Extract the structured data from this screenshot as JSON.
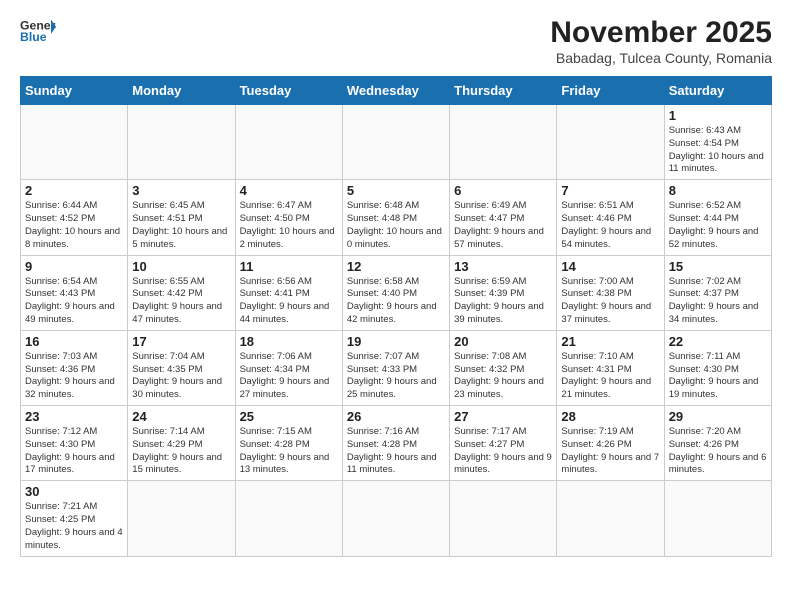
{
  "header": {
    "logo_general": "General",
    "logo_blue": "Blue",
    "month_title": "November 2025",
    "location": "Babadag, Tulcea County, Romania"
  },
  "days_of_week": [
    "Sunday",
    "Monday",
    "Tuesday",
    "Wednesday",
    "Thursday",
    "Friday",
    "Saturday"
  ],
  "weeks": [
    [
      {
        "day": "",
        "info": ""
      },
      {
        "day": "",
        "info": ""
      },
      {
        "day": "",
        "info": ""
      },
      {
        "day": "",
        "info": ""
      },
      {
        "day": "",
        "info": ""
      },
      {
        "day": "",
        "info": ""
      },
      {
        "day": "1",
        "info": "Sunrise: 6:43 AM\nSunset: 4:54 PM\nDaylight: 10 hours and 11 minutes."
      }
    ],
    [
      {
        "day": "2",
        "info": "Sunrise: 6:44 AM\nSunset: 4:52 PM\nDaylight: 10 hours and 8 minutes."
      },
      {
        "day": "3",
        "info": "Sunrise: 6:45 AM\nSunset: 4:51 PM\nDaylight: 10 hours and 5 minutes."
      },
      {
        "day": "4",
        "info": "Sunrise: 6:47 AM\nSunset: 4:50 PM\nDaylight: 10 hours and 2 minutes."
      },
      {
        "day": "5",
        "info": "Sunrise: 6:48 AM\nSunset: 4:48 PM\nDaylight: 10 hours and 0 minutes."
      },
      {
        "day": "6",
        "info": "Sunrise: 6:49 AM\nSunset: 4:47 PM\nDaylight: 9 hours and 57 minutes."
      },
      {
        "day": "7",
        "info": "Sunrise: 6:51 AM\nSunset: 4:46 PM\nDaylight: 9 hours and 54 minutes."
      },
      {
        "day": "8",
        "info": "Sunrise: 6:52 AM\nSunset: 4:44 PM\nDaylight: 9 hours and 52 minutes."
      }
    ],
    [
      {
        "day": "9",
        "info": "Sunrise: 6:54 AM\nSunset: 4:43 PM\nDaylight: 9 hours and 49 minutes."
      },
      {
        "day": "10",
        "info": "Sunrise: 6:55 AM\nSunset: 4:42 PM\nDaylight: 9 hours and 47 minutes."
      },
      {
        "day": "11",
        "info": "Sunrise: 6:56 AM\nSunset: 4:41 PM\nDaylight: 9 hours and 44 minutes."
      },
      {
        "day": "12",
        "info": "Sunrise: 6:58 AM\nSunset: 4:40 PM\nDaylight: 9 hours and 42 minutes."
      },
      {
        "day": "13",
        "info": "Sunrise: 6:59 AM\nSunset: 4:39 PM\nDaylight: 9 hours and 39 minutes."
      },
      {
        "day": "14",
        "info": "Sunrise: 7:00 AM\nSunset: 4:38 PM\nDaylight: 9 hours and 37 minutes."
      },
      {
        "day": "15",
        "info": "Sunrise: 7:02 AM\nSunset: 4:37 PM\nDaylight: 9 hours and 34 minutes."
      }
    ],
    [
      {
        "day": "16",
        "info": "Sunrise: 7:03 AM\nSunset: 4:36 PM\nDaylight: 9 hours and 32 minutes."
      },
      {
        "day": "17",
        "info": "Sunrise: 7:04 AM\nSunset: 4:35 PM\nDaylight: 9 hours and 30 minutes."
      },
      {
        "day": "18",
        "info": "Sunrise: 7:06 AM\nSunset: 4:34 PM\nDaylight: 9 hours and 27 minutes."
      },
      {
        "day": "19",
        "info": "Sunrise: 7:07 AM\nSunset: 4:33 PM\nDaylight: 9 hours and 25 minutes."
      },
      {
        "day": "20",
        "info": "Sunrise: 7:08 AM\nSunset: 4:32 PM\nDaylight: 9 hours and 23 minutes."
      },
      {
        "day": "21",
        "info": "Sunrise: 7:10 AM\nSunset: 4:31 PM\nDaylight: 9 hours and 21 minutes."
      },
      {
        "day": "22",
        "info": "Sunrise: 7:11 AM\nSunset: 4:30 PM\nDaylight: 9 hours and 19 minutes."
      }
    ],
    [
      {
        "day": "23",
        "info": "Sunrise: 7:12 AM\nSunset: 4:30 PM\nDaylight: 9 hours and 17 minutes."
      },
      {
        "day": "24",
        "info": "Sunrise: 7:14 AM\nSunset: 4:29 PM\nDaylight: 9 hours and 15 minutes."
      },
      {
        "day": "25",
        "info": "Sunrise: 7:15 AM\nSunset: 4:28 PM\nDaylight: 9 hours and 13 minutes."
      },
      {
        "day": "26",
        "info": "Sunrise: 7:16 AM\nSunset: 4:28 PM\nDaylight: 9 hours and 11 minutes."
      },
      {
        "day": "27",
        "info": "Sunrise: 7:17 AM\nSunset: 4:27 PM\nDaylight: 9 hours and 9 minutes."
      },
      {
        "day": "28",
        "info": "Sunrise: 7:19 AM\nSunset: 4:26 PM\nDaylight: 9 hours and 7 minutes."
      },
      {
        "day": "29",
        "info": "Sunrise: 7:20 AM\nSunset: 4:26 PM\nDaylight: 9 hours and 6 minutes."
      }
    ],
    [
      {
        "day": "30",
        "info": "Sunrise: 7:21 AM\nSunset: 4:25 PM\nDaylight: 9 hours and 4 minutes."
      },
      {
        "day": "",
        "info": ""
      },
      {
        "day": "",
        "info": ""
      },
      {
        "day": "",
        "info": ""
      },
      {
        "day": "",
        "info": ""
      },
      {
        "day": "",
        "info": ""
      },
      {
        "day": "",
        "info": ""
      }
    ]
  ]
}
